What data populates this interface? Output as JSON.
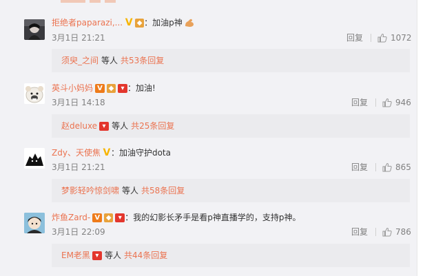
{
  "comments": [
    {
      "username": "拒绝者paparazi,...",
      "text": "：加油p神",
      "date": "3月1日 21:21",
      "reply_label": "回复",
      "likes": "1072",
      "sub_user": "须臾_之间",
      "sub_suffix": "等人",
      "sub_total": "共53条回复"
    },
    {
      "username": "英斗小妈妈",
      "text": "：加油!",
      "date": "3月1日 14:18",
      "reply_label": "回复",
      "likes": "946",
      "sub_user": "赵deluxe",
      "sub_suffix": "等人",
      "sub_total": "共25条回复"
    },
    {
      "username": "Zdy、天使焦",
      "text": "：加油守护dota",
      "date": "3月1日 21:21",
      "reply_label": "回复",
      "likes": "865",
      "sub_user": "梦影轻吟惊剑啸",
      "sub_suffix": "等人",
      "sub_total": "共58条回复"
    },
    {
      "username": "炸鱼Zard-",
      "text": "：我的幻影长矛手是看p神直播学的，支持p神。",
      "date": "3月1日 22:09",
      "reply_label": "回复",
      "likes": "786",
      "sub_user": "EM老黑",
      "sub_suffix": "等人",
      "sub_total": "共44条回复"
    }
  ],
  "colors": {
    "username": "#eb7350",
    "meta": "#808080",
    "panel_bg": "#f2f2f5",
    "subbox_bg": "#ebebee"
  },
  "icons": {
    "like": "thumbs-up-icon",
    "verified": "verified-v-icon",
    "vip": "vip-badge-icon",
    "red_envelope": "red-envelope-icon",
    "flex_arm": "flexed-arm-emoji"
  }
}
